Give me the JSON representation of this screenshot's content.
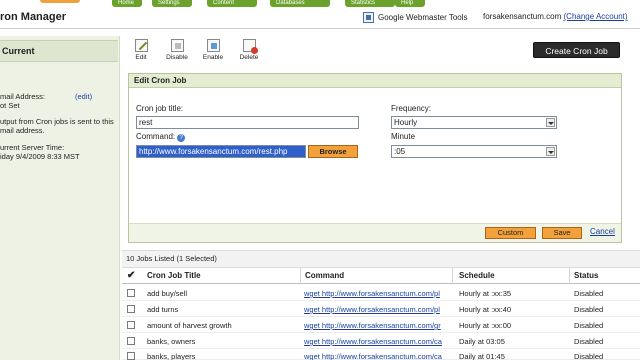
{
  "nav": {
    "tabs": [
      "Home",
      "Settings",
      "Content",
      "Databases",
      "Statistics",
      "Help"
    ]
  },
  "header": {
    "title": "ron Manager",
    "gwt_label": "Google Webmaster Tools",
    "account_site": "forsakensanctum.com",
    "account_link": "(Change Account)"
  },
  "sidebar": {
    "current_label": "Current",
    "email_label": "mail Address:",
    "email_value": "ot Set",
    "edit_link": "(edit)",
    "note_1": "utput from Cron jobs is sent to this",
    "note_2": "mail address.",
    "server_time_label": "urrent Server Time:",
    "server_time_value": "iday 9/4/2009 8:33 MST"
  },
  "toolbar": {
    "edit": "Edit",
    "disable": "Disable",
    "enable": "Enable",
    "delete": "Delete",
    "create_button": "Create Cron Job"
  },
  "edit_panel": {
    "title": "Edit Cron Job",
    "job_title_label": "Cron job title:",
    "job_title_value": "rest",
    "command_label": "Command:",
    "command_value": "http://www.forsakensanctum.com/rest.php",
    "browse": "Browse",
    "frequency_label": "Frequency:",
    "frequency_value": "Hourly",
    "minute_label": "Minute",
    "minute_value": ":05",
    "custom": "Custom",
    "save": "Save",
    "cancel": "Cancel"
  },
  "jobs": {
    "count_text": "10 Jobs Listed (1 Selected)",
    "columns": [
      "Cron Job Title",
      "Command",
      "Schedule",
      "Status"
    ],
    "rows": [
      {
        "title": "add buy/sell",
        "command": "wget http://www.forsakensanctum.com/pl",
        "schedule": "Hourly at :xx:35",
        "status": "Disabled"
      },
      {
        "title": "add turns",
        "command": "wget http://www.forsakensanctum.com/pl",
        "schedule": "Hourly at :xx:40",
        "status": "Disabled"
      },
      {
        "title": "amount of harvest growth",
        "command": "wget http://www.forsakensanctum.com/gr",
        "schedule": "Hourly at :xx:00",
        "status": "Disabled"
      },
      {
        "title": "banks, owners",
        "command": "wget http://www.forsakensanctum.com/ca",
        "schedule": "Daily at 03:05",
        "status": "Disabled"
      },
      {
        "title": "banks, players",
        "command": "wget http://www.forsakensanctum.com/ca",
        "schedule": "Daily at 01:45",
        "status": "Disabled"
      }
    ]
  }
}
